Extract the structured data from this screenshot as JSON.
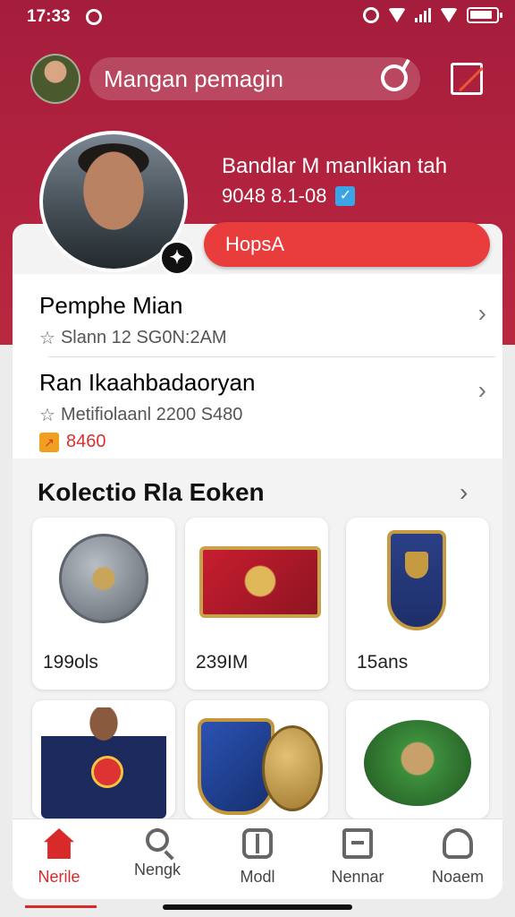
{
  "status_bar": {
    "time": "17:33"
  },
  "header": {
    "search_text": "Mangan pemagin"
  },
  "profile": {
    "name": "Bandlar M manlkian tah",
    "meta": "9048 8.1-08",
    "cta_label": "HopsA"
  },
  "list": [
    {
      "title": "Pemphe Mian",
      "sub": "Slann 12 SG0N:2AM"
    },
    {
      "title": "Ran Ikaahbadaoryan",
      "sub": "Metifiolaanl 2200 S480",
      "tag": "8460"
    }
  ],
  "collection": {
    "title": "Kolectio Rla Eoken",
    "tiles": [
      {
        "label": "199ols",
        "icon": "silver-coin-icon"
      },
      {
        "label": "239IM",
        "icon": "red-badge-icon"
      },
      {
        "label": "15ans",
        "icon": "blue-shield-icon"
      },
      {
        "label": "",
        "icon": "jersey-player-icon"
      },
      {
        "label": "",
        "icon": "shield-coin-icon"
      },
      {
        "label": "",
        "icon": "green-disc-icon"
      }
    ]
  },
  "nav": [
    {
      "label": "Nerile",
      "icon": "home-icon",
      "active": true
    },
    {
      "label": "Nengk",
      "icon": "search-icon"
    },
    {
      "label": "Modl",
      "icon": "model-icon"
    },
    {
      "label": "Nennar",
      "icon": "news-icon"
    },
    {
      "label": "Noaem",
      "icon": "profile-icon"
    }
  ],
  "colors": {
    "brand": "#a51d3c",
    "accent": "#e93c3c",
    "active": "#d92a2a"
  }
}
